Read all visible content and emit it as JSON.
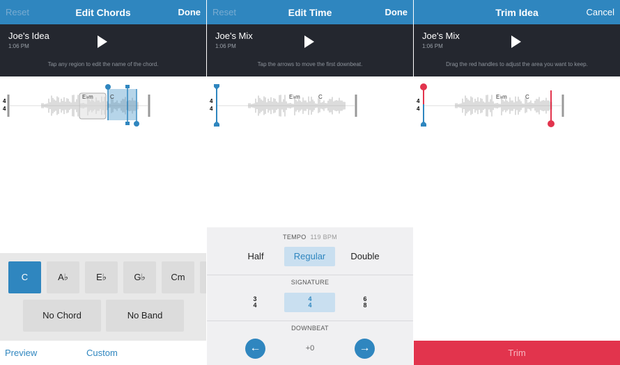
{
  "panels": {
    "chords": {
      "nav": {
        "left": "Reset",
        "title": "Edit Chords",
        "right": "Done"
      },
      "song": {
        "name": "Joe's Idea",
        "time": "1:06 PM"
      },
      "hint": "Tap any region to edit the name of the chord.",
      "wave": {
        "ts_top": "4",
        "ts_bottom": "4",
        "chord1": "E♭m",
        "chord2": "C"
      },
      "chords": [
        "C",
        "A♭",
        "E♭",
        "G♭",
        "Cm"
      ],
      "selected_chord": "C",
      "no_chord": "No Chord",
      "no_band": "No Band",
      "preview": "Preview",
      "custom": "Custom"
    },
    "time": {
      "nav": {
        "left": "Reset",
        "title": "Edit Time",
        "right": "Done"
      },
      "song": {
        "name": "Joe's Mix",
        "time": "1:06 PM"
      },
      "hint": "Tap the arrows to move the first downbeat.",
      "wave": {
        "ts_top": "4",
        "ts_bottom": "4",
        "chord1": "E♭m",
        "chord2": "C"
      },
      "tempo_label": "TEMPO",
      "tempo_value": "119 BPM",
      "half": "Half",
      "regular": "Regular",
      "double": "Double",
      "signature_label": "SIGNATURE",
      "signatures": [
        {
          "top": "3",
          "bottom": "4"
        },
        {
          "top": "4",
          "bottom": "4"
        },
        {
          "top": "6",
          "bottom": "8"
        }
      ],
      "downbeat_label": "DOWNBEAT",
      "downbeat_value": "+0"
    },
    "trim": {
      "nav": {
        "title": "Trim Idea",
        "right": "Cancel"
      },
      "song": {
        "name": "Joe's Mix",
        "time": "1:06 PM"
      },
      "hint": "Drag the red handles to adjust the area you want to keep.",
      "wave": {
        "ts_top": "4",
        "ts_bottom": "4",
        "chord1": "E♭m",
        "chord2": "C"
      },
      "trim_button": "Trim"
    }
  },
  "colors": {
    "accent": "#2f86bf",
    "trim_red": "#e2344d",
    "dark": "#24272f"
  }
}
